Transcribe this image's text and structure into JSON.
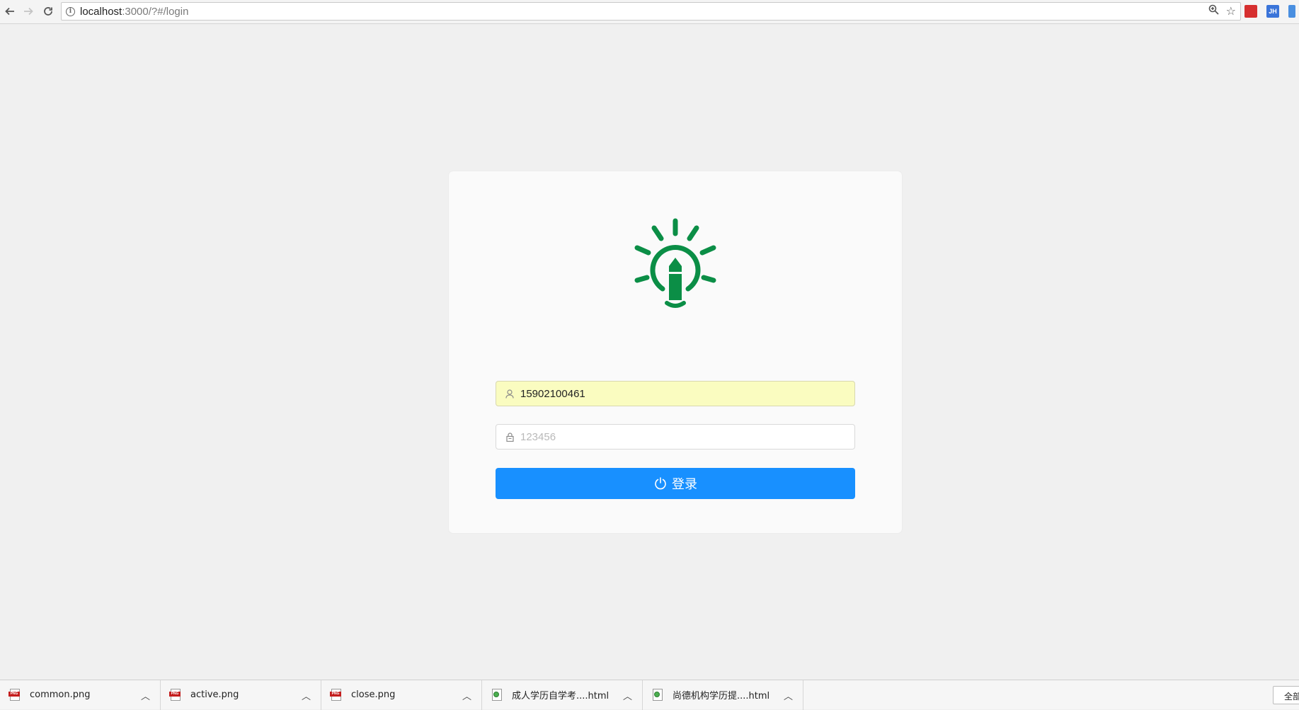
{
  "browser": {
    "url_host": "localhost",
    "url_rest": ":3000/?#/login",
    "extensions": [
      " ",
      "JH"
    ]
  },
  "login": {
    "username_value": "15902100461",
    "password_placeholder": "123456",
    "button_label": "登录",
    "accent_color": "#1890ff",
    "logo_color": "#0b8e46",
    "autofill_color": "#fafcc0"
  },
  "downloads": {
    "items": [
      {
        "name": "common.png",
        "type": "png"
      },
      {
        "name": "active.png",
        "type": "png"
      },
      {
        "name": "close.png",
        "type": "png"
      },
      {
        "name": "成人学历自学考....html",
        "type": "html"
      },
      {
        "name": "尚德机构学历提....html",
        "type": "html"
      }
    ],
    "show_all_label": "全部"
  }
}
